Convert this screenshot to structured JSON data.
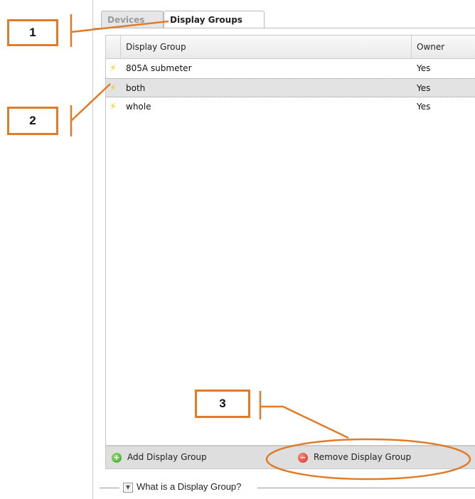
{
  "tabs": [
    {
      "label": "Devices",
      "active": false
    },
    {
      "label": "Display Groups",
      "active": true
    }
  ],
  "grid": {
    "columns": {
      "name": "Display Group",
      "owner": "Owner"
    },
    "rows": [
      {
        "name": "805A submeter",
        "owner": "Yes",
        "selected": false,
        "icon": "lightning-bolt-icon"
      },
      {
        "name": "both",
        "owner": "Yes",
        "selected": true,
        "icon": "lightning-bolt-icon"
      },
      {
        "name": "whole",
        "owner": "Yes",
        "selected": false,
        "icon": "lightning-bolt-icon"
      }
    ]
  },
  "footer": {
    "add_label": "Add Display Group",
    "add_icon": "green-plus-circle-icon",
    "remove_label": "Remove Display Group",
    "remove_icon": "red-minus-circle-icon"
  },
  "help": {
    "label": "What is a Display Group?",
    "icon": "expand-toggle-icon"
  },
  "annotations": [
    {
      "number": "1"
    },
    {
      "number": "2"
    },
    {
      "number": "3"
    }
  ],
  "colors": {
    "annotation": "#e07b2a",
    "bolt": "#f2c400",
    "selected_row": "#e3e3e3"
  }
}
